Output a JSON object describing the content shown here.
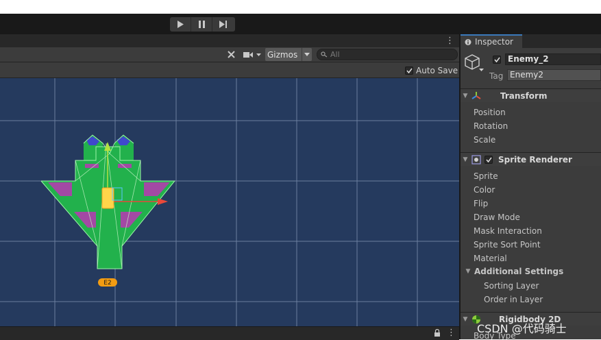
{
  "play_controls": {
    "play": "play-icon",
    "pause": "pause-icon",
    "step": "step-icon"
  },
  "scene_toolbar": {
    "gizmos_label": "Gizmos",
    "search_placeholder": "All"
  },
  "prefab_bar": {
    "auto_save_label": "Auto Save",
    "auto_save_checked": true
  },
  "viewport": {
    "object_label": "E2",
    "grid_color": "#8b9bb4",
    "background": "#253a5e"
  },
  "inspector": {
    "tab_label": "Inspector",
    "object_active": true,
    "object_name": "Enemy_2",
    "tag_label": "Tag",
    "tag_value": "Enemy2",
    "components": [
      {
        "name": "Transform",
        "icon": "transform-icon",
        "props": [
          "Position",
          "Rotation",
          "Scale"
        ]
      },
      {
        "name": "Sprite Renderer",
        "icon": "sprite-renderer-icon",
        "enabled": true,
        "props": [
          "Sprite",
          "Color",
          "Flip",
          "Draw Mode",
          "Mask Interaction",
          "Sprite Sort Point",
          "Material"
        ],
        "sub_section": {
          "label": "Additional Settings",
          "props": [
            "Sorting Layer",
            "Order in Layer"
          ]
        }
      },
      {
        "name": "Rigidbody 2D",
        "icon": "rigidbody-icon",
        "props": [
          "Body Type"
        ]
      }
    ]
  },
  "watermark": "CSDN @代码骑士"
}
